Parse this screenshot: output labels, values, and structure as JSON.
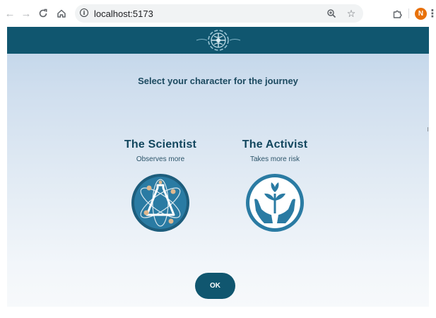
{
  "browser": {
    "url": "localhost:5173",
    "profile_initial": "N",
    "icons": [
      "back-icon",
      "forward-icon",
      "reload-icon",
      "home-icon",
      "info-icon",
      "zoom-icon",
      "star-icon",
      "extensions-icon",
      "menu-icon"
    ]
  },
  "page": {
    "heading": "Select your character for the journey",
    "characters": [
      {
        "title": "The Scientist",
        "subtitle": "Observes more",
        "icon": "atom-flask-icon"
      },
      {
        "title": "The Activist",
        "subtitle": "Takes more risk",
        "icon": "hands-plant-icon"
      }
    ],
    "ok_label": "OK"
  },
  "colors": {
    "header": "#10566f",
    "button": "#10566f",
    "heading_text": "#1c4a60",
    "background_top": "#bdd3e8",
    "background_bottom": "#f7f9fb"
  }
}
